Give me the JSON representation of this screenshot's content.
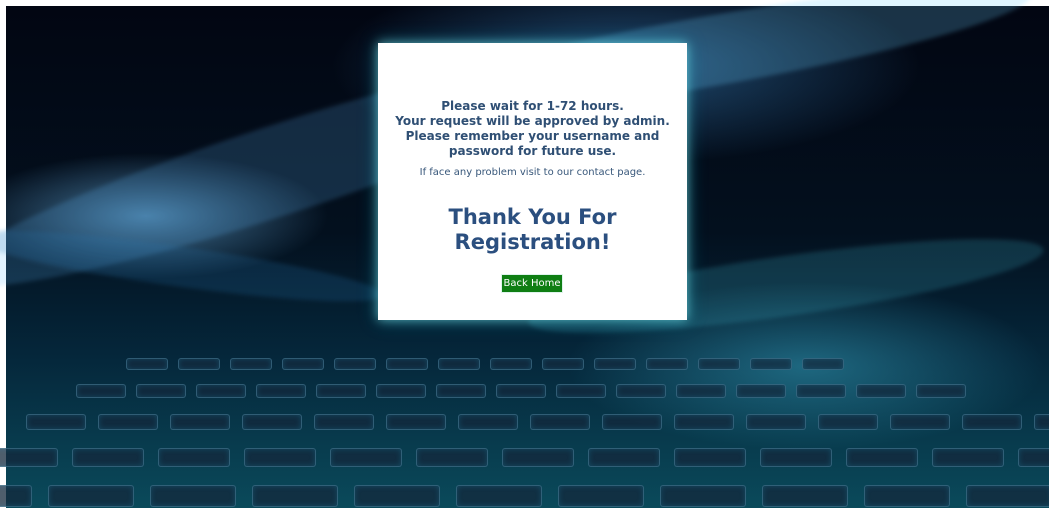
{
  "notice": {
    "lines": [
      "Please wait for 1-72 hours.",
      "Your request will be approved by admin.",
      "Please remember your username and",
      "password for future use."
    ],
    "contact_note": "If face any problem visit to our contact page."
  },
  "thanks": {
    "lines": [
      "Thank You For",
      "Registration!"
    ]
  },
  "actions": {
    "back_home_label": "Back Home"
  },
  "colors": {
    "text_primary": "#2f4f74",
    "heading": "#2b4f7f",
    "button_bg": "#0f7e13",
    "button_text": "#ffffff",
    "dialog_glow": "#a0ffff"
  }
}
